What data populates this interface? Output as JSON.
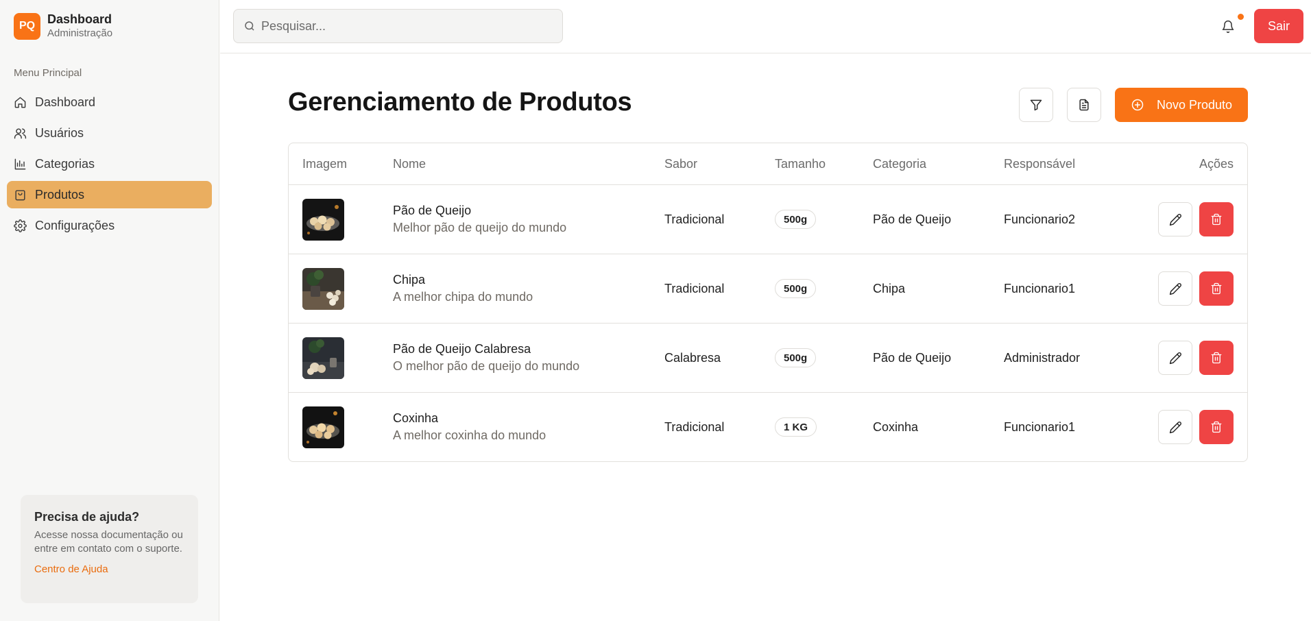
{
  "brand": {
    "logo": "PQ",
    "title": "Dashboard",
    "subtitle": "Administração"
  },
  "sidebar": {
    "menu_label": "Menu Principal",
    "items": [
      {
        "label": "Dashboard",
        "icon": "home-icon"
      },
      {
        "label": "Usuários",
        "icon": "users-icon"
      },
      {
        "label": "Categorias",
        "icon": "bar-chart-icon"
      },
      {
        "label": "Produtos",
        "icon": "shopping-bag-icon",
        "active": true
      },
      {
        "label": "Configurações",
        "icon": "gear-icon"
      }
    ],
    "help": {
      "title": "Precisa de ajuda?",
      "text": "Acesse nossa documentação ou entre em contato com o suporte.",
      "link": "Centro de Ajuda"
    }
  },
  "topbar": {
    "search_placeholder": "Pesquisar...",
    "search_value": "",
    "logout": "Sair"
  },
  "main": {
    "title": "Gerenciamento de Produtos",
    "new_button": "Novo Produto",
    "columns": [
      "Imagem",
      "Nome",
      "Sabor",
      "Tamanho",
      "Categoria",
      "Responsável",
      "Ações"
    ],
    "products": [
      {
        "name": "Pão de Queijo",
        "description": "Melhor pão de queijo do mundo",
        "flavor": "Tradicional",
        "size": "500g",
        "category": "Pão de Queijo",
        "owner": "Funcionario2"
      },
      {
        "name": "Chipa",
        "description": "A melhor chipa do mundo",
        "flavor": "Tradicional",
        "size": "500g",
        "category": "Chipa",
        "owner": "Funcionario1"
      },
      {
        "name": "Pão de Queijo Calabresa",
        "description": "O melhor pão de queijo do mundo",
        "flavor": "Calabresa",
        "size": "500g",
        "category": "Pão de Queijo",
        "owner": "Administrador"
      },
      {
        "name": "Coxinha",
        "description": "A melhor coxinha do mundo",
        "flavor": "Tradicional",
        "size": "1 KG",
        "category": "Coxinha",
        "owner": "Funcionario1"
      }
    ]
  },
  "colors": {
    "accent": "#f97316",
    "danger": "#ef4444",
    "active_menu": "#eaae60"
  }
}
